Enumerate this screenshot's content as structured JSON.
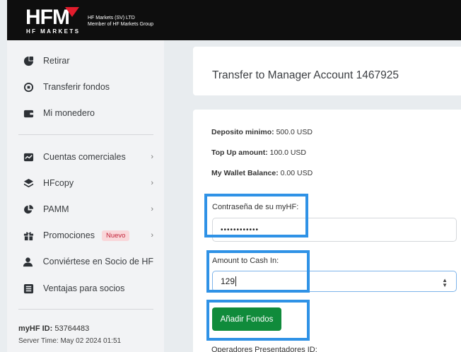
{
  "header": {
    "logo_text": "HFM",
    "logo_subtext": "HF MARKETS",
    "company_line1": "HF Markets (SV) LTD",
    "company_line2": "Member of HF Markets Group"
  },
  "sidebar": {
    "items": [
      {
        "label": "Retirar",
        "icon": "wallet-out-icon"
      },
      {
        "label": "Transferir fondos",
        "icon": "transfer-icon"
      },
      {
        "label": "Mi monedero",
        "icon": "wallet-icon"
      },
      {
        "label": "Cuentas comerciales",
        "icon": "chart-line-icon"
      },
      {
        "label": "HFcopy",
        "icon": "layers-icon"
      },
      {
        "label": "PAMM",
        "icon": "pie-chart-icon"
      },
      {
        "label": "Promociones",
        "icon": "gift-icon",
        "badge": "Nuevo"
      },
      {
        "label": "Conviértese en Socio de HF",
        "icon": "user-icon"
      },
      {
        "label": "Ventajas para socios",
        "icon": "list-icon"
      }
    ],
    "myhf_label": "myHF ID:",
    "myhf_value": "53764483",
    "server_time": "Server Time: May 02 2024 01:51"
  },
  "main": {
    "title": "Transfer to Manager Account 1467925",
    "deposit_min_label": "Deposito minimo:",
    "deposit_min_value": "500.0 USD",
    "topup_label": "Top Up amount:",
    "topup_value": "100.0 USD",
    "wallet_label": "My Wallet Balance:",
    "wallet_value": "0.00 USD",
    "password_label": "Contraseña de su myHF:",
    "password_value": "••••••••••••",
    "amount_label": "Amount to Cash In:",
    "amount_value": "129",
    "submit_label": "Añadir Fondos",
    "ib_label": "Operadores Presentadores ID:"
  },
  "colors": {
    "header_bg": "#0e0e0e",
    "logo_accent": "#e21c2c",
    "button_green": "#108b3b",
    "highlight_blue": "#2f92e6",
    "badge_bg": "#f9d7da",
    "badge_text": "#c2233a"
  }
}
